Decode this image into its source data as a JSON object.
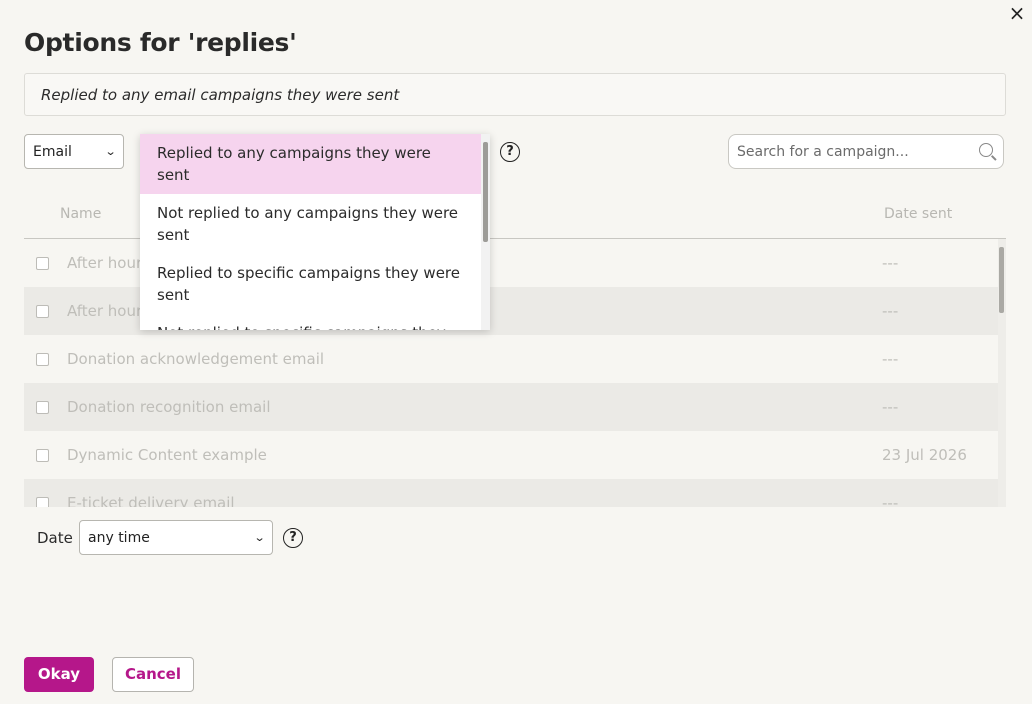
{
  "dialog": {
    "title": "Options for 'replies'",
    "summary": "Replied to any email campaigns they were sent",
    "close_icon": "×"
  },
  "filter": {
    "type_value": "Email",
    "options": [
      "Replied to any campaigns they were sent",
      "Not replied to any campaigns they were sent",
      "Replied to specific campaigns they were sent",
      "Not replied to specific campaigns they"
    ],
    "selected_index": 0,
    "help_symbol": "?"
  },
  "search": {
    "placeholder": "Search for a campaign..."
  },
  "table": {
    "headers": {
      "name": "Name",
      "date": "Date sent"
    },
    "rows": [
      {
        "name": "After hours",
        "date": "---"
      },
      {
        "name": "After hours",
        "date": "---"
      },
      {
        "name": "Donation acknowledgement email",
        "date": "---"
      },
      {
        "name": "Donation recognition email",
        "date": "---"
      },
      {
        "name": "Dynamic Content example",
        "date": "23 Jul 2026"
      },
      {
        "name": "E-ticket delivery email",
        "date": "---"
      }
    ]
  },
  "date_filter": {
    "label": "Date",
    "value": "any time",
    "help_symbol": "?"
  },
  "buttons": {
    "okay": "Okay",
    "cancel": "Cancel"
  },
  "colors": {
    "accent": "#b5178a",
    "selected_option_bg": "#f6d4ee"
  }
}
